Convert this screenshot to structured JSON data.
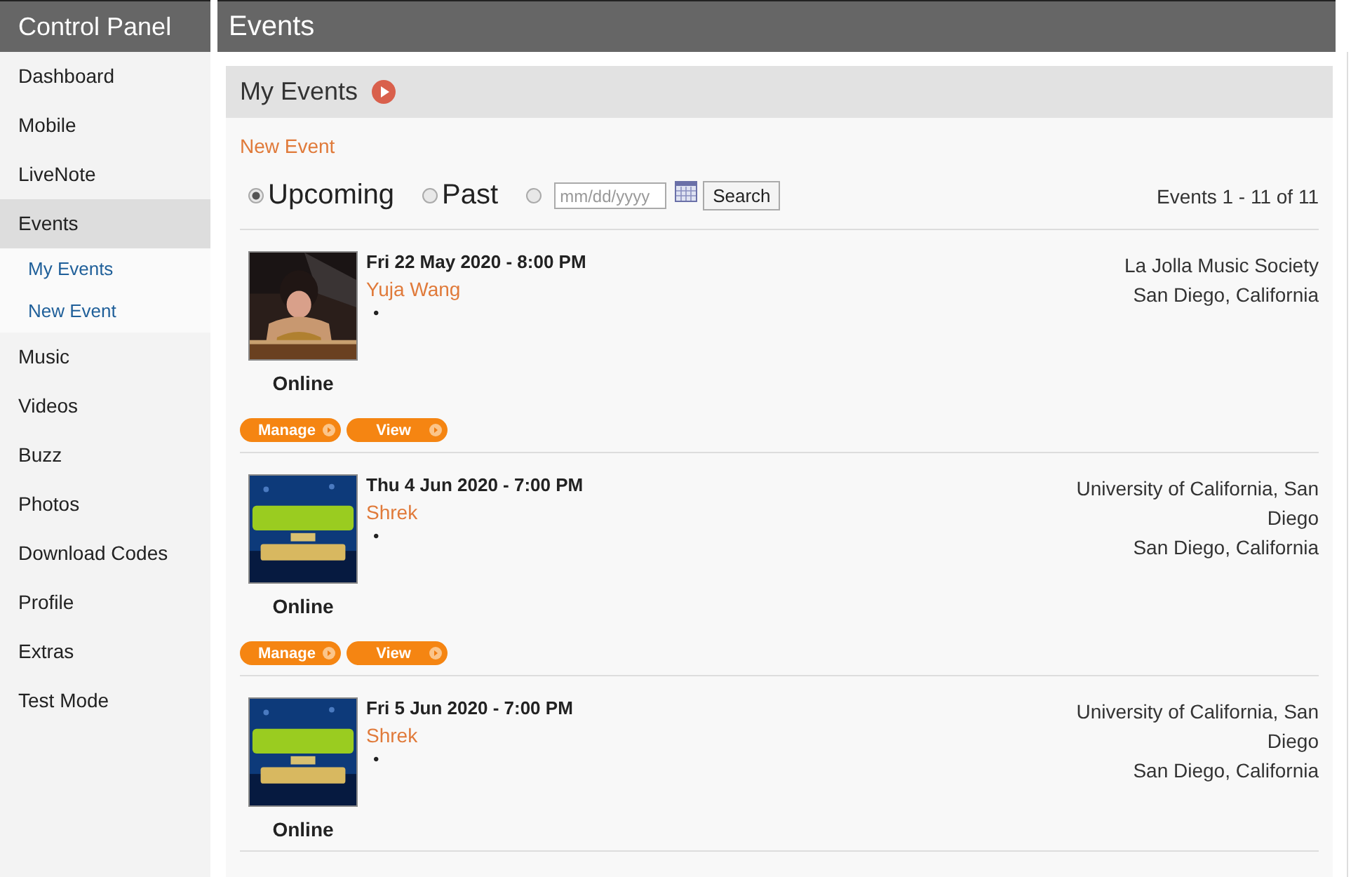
{
  "sidebar": {
    "title": "Control Panel",
    "items": [
      {
        "label": "Dashboard",
        "selected": false
      },
      {
        "label": "Mobile",
        "selected": false
      },
      {
        "label": "LiveNote",
        "selected": false
      },
      {
        "label": "Events",
        "selected": true,
        "children": [
          {
            "label": "My Events"
          },
          {
            "label": "New Event"
          }
        ]
      },
      {
        "label": "Music",
        "selected": false
      },
      {
        "label": "Videos",
        "selected": false
      },
      {
        "label": "Buzz",
        "selected": false
      },
      {
        "label": "Photos",
        "selected": false
      },
      {
        "label": "Download Codes",
        "selected": false
      },
      {
        "label": "Profile",
        "selected": false
      },
      {
        "label": "Extras",
        "selected": false
      },
      {
        "label": "Test Mode",
        "selected": false
      }
    ]
  },
  "page_title": "Events",
  "panel": {
    "title": "My Events",
    "new_event_link": "New Event",
    "filters": [
      {
        "label": "Upcoming",
        "selected": true
      },
      {
        "label": "Past",
        "selected": false
      },
      {
        "placeholder": "mm/dd/yyyy",
        "selected": false
      }
    ],
    "search_button": "Search",
    "count": "Events 1 - 11 of 11",
    "events": [
      {
        "kind": "picture",
        "date": "Fri 22 May 2020 - 8:00 PM",
        "title": "Yuja Wang",
        "bullet": "•",
        "status": "Online",
        "venue": "La Jolla Music Society",
        "city": "San Diego, California",
        "buttons": [
          "Manage",
          "View"
        ]
      },
      {
        "kind": "picture",
        "date": "Thu 4 Jun 2020 - 7:00 PM",
        "title": "Shrek",
        "bullet": "•",
        "status": "Online",
        "venue": "University of California, San Diego",
        "city": "San Diego, California",
        "buttons": [
          "Manage",
          "View"
        ]
      },
      {
        "kind": "picture",
        "date": "Fri 5 Jun 2020 - 7:00 PM",
        "title": "Shrek",
        "bullet": "•",
        "status": "Online",
        "venue": "University of California, San Diego",
        "city": "San Diego, California"
      }
    ]
  }
}
